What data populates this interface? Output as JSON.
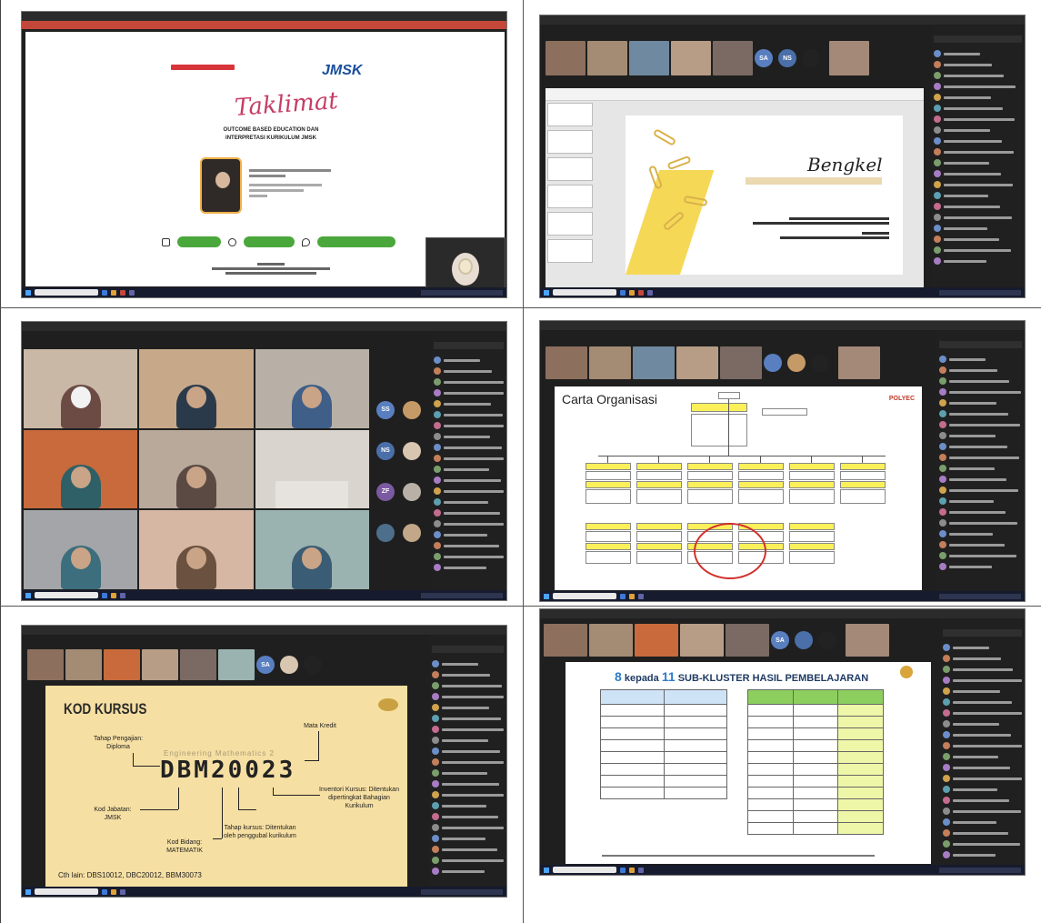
{
  "shot1": {
    "slide": {
      "title_script": "Taklimat",
      "heading_line1": "OUTCOME BASED EDUCATION DAN",
      "heading_line2": "INTERPRETASI KURIKULUM JMSK",
      "logo_right": "JMSK"
    }
  },
  "shot2": {
    "slide": {
      "title": "Bengkel"
    }
  },
  "shot4": {
    "slide": {
      "title": "Carta Organisasi",
      "logo": "POLYEC"
    }
  },
  "shot5": {
    "slide": {
      "title": "KOD KURSUS",
      "subtitle": "Engineering Mathematics 2",
      "code": "DBM20023",
      "labels": {
        "tahap_pengajian": "Tahap Pengajian: Diploma",
        "mata_kredit": "Mata Kredit",
        "inventori": "Inventori Kursus: Ditentukan dipertingkat Bahagian Kurikulum",
        "kod_jabatan": "Kod Jabatan: JMSK",
        "kod_bidang": "Kod Bidang: MATEMATIK",
        "tahap_kursus": "Tahap kursus: Ditentukan oleh penggubal kurikulum"
      },
      "example": "Cth lain: DBS10012, DBC20012, BBM30073"
    }
  },
  "shot6": {
    "slide": {
      "title_num1": "8",
      "title_kepada": "kepada",
      "title_num2": "11",
      "title_rest": "SUB-KLUSTER HASIL PEMBELAJARAN"
    }
  },
  "strip_avatars": {
    "s2": [
      "SA",
      "NS"
    ],
    "s3": [
      "SS",
      "NS",
      "ZF"
    ],
    "s5": [
      "SA"
    ],
    "s6": [
      "SA"
    ]
  },
  "colors": {
    "teams_bg": "#1f1f1f",
    "leave_red": "#c4314b",
    "slide_green": "#4aa73b",
    "kod_bg": "#f6dfa2",
    "org_yellow": "#fbf05a"
  }
}
